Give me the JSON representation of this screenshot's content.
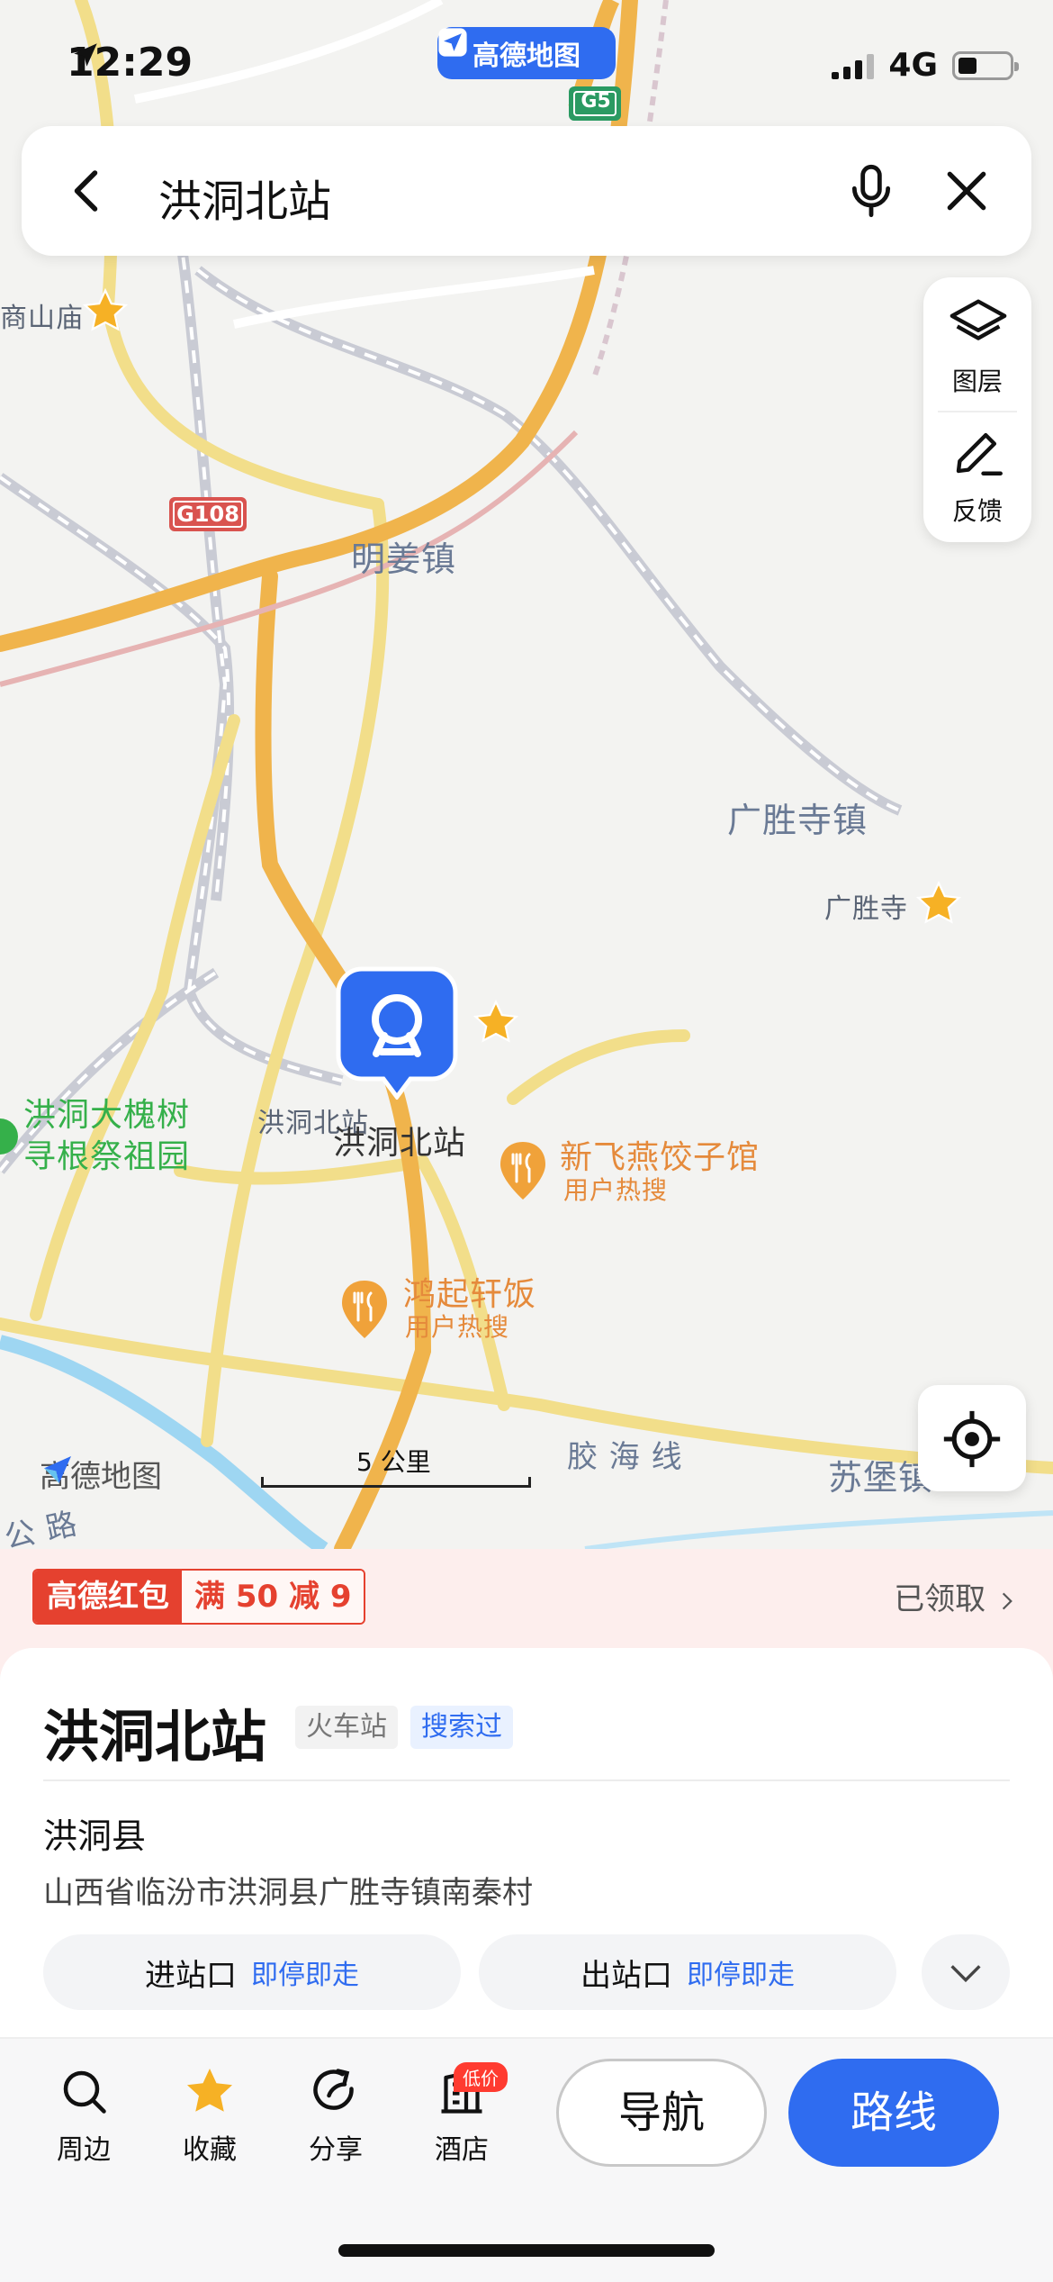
{
  "status_bar": {
    "time": "12:29",
    "network": "4G"
  },
  "top_badge": {
    "label": "高德地图"
  },
  "search": {
    "query": "洪洞北站"
  },
  "map": {
    "road_shields": {
      "g5": "G5",
      "g108": "G108"
    },
    "labels": {
      "shangshan": "商山庙",
      "mingjiang": "明姜镇",
      "guangsheng_town": "广胜寺镇",
      "guangsheng_temple": "广胜寺",
      "station_small": "洪洞北站",
      "station_main": "洪洞北站",
      "huaishu_line1": "洪洞大槐树",
      "huaishu_line2": "寻根祭祖园",
      "restaurant1": "新飞燕饺子馆",
      "restaurant1_sub": "用户热搜",
      "restaurant2": "鸿起轩饭",
      "restaurant2_sub": "用户热搜",
      "railway": "胶 海 线",
      "supu": "苏堡镇",
      "road_partial": "公 路"
    },
    "scale": "5 公里",
    "watermark": "高德地图"
  },
  "tools": {
    "layers": "图层",
    "feedback": "反馈"
  },
  "promo": {
    "tag_brand": "高德红包",
    "tag_offer": "满 50 减 9",
    "status": "已领取"
  },
  "place": {
    "name": "洪洞北站",
    "category": "火车站",
    "history_tag": "搜索过",
    "county": "洪洞县",
    "address": "山西省临汾市洪洞县广胜寺镇南秦村",
    "entrances": [
      {
        "label": "进站口",
        "note": "即停即走"
      },
      {
        "label": "出站口",
        "note": "即停即走"
      }
    ]
  },
  "bottom_bar": {
    "nearby": "周边",
    "favorite": "收藏",
    "share": "分享",
    "hotel": "酒店",
    "hotel_badge": "低价",
    "navigate": "导航",
    "route": "路线"
  },
  "colors": {
    "accent": "#2f6cf0",
    "promo_red": "#e5412f"
  }
}
